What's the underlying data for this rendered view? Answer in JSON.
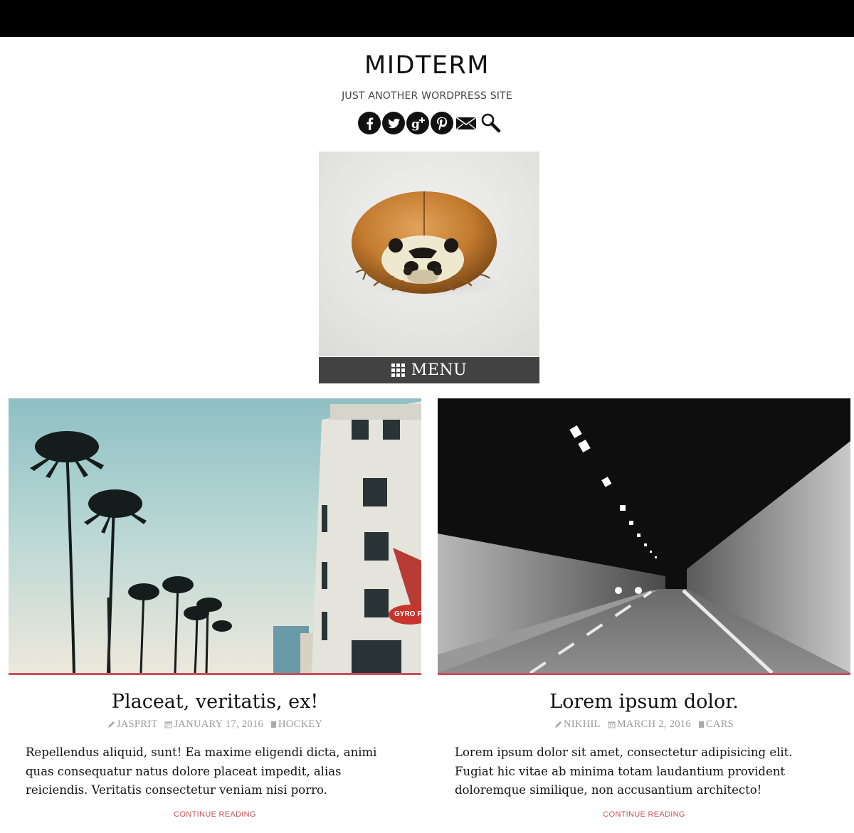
{
  "site": {
    "title": "MIDTERM",
    "tagline": "JUST ANOTHER WORDPRESS SITE"
  },
  "social_icons": [
    "facebook-icon",
    "twitter-icon",
    "google-plus-icon",
    "pinterest-icon",
    "email-icon",
    "search-icon"
  ],
  "menu": {
    "label": "MENU",
    "icon": "grid-icon"
  },
  "colors": {
    "accent": "#c9505a",
    "menu_bg": "#424242",
    "meta": "#999999",
    "topbar": "#000000"
  },
  "posts": [
    {
      "title": "Placeat, veritatis, ex!",
      "author": "JASPRIT",
      "date": "JANUARY 17, 2016",
      "category": "HOCKEY",
      "excerpt": "Repellendus aliquid, sunt! Ea maxime eligendi dicta, animi quas consequatur natus dolore placeat impedit, alias reiciendis. Veritatis consectetur veniam nisi porro.",
      "more": "CONTINUE READING",
      "image": "palm-trees-street-photo",
      "sign_text": "GYRO FALAFEL"
    },
    {
      "title": "Lorem ipsum dolor.",
      "author": "NIKHIL",
      "date": "MARCH 2, 2016",
      "category": "CARS",
      "excerpt": "Lorem ipsum dolor sit amet, consectetur adipisicing elit. Fugiat hic vitae ab minima totam laudantium provident doloremque similique, non accusantium architecto!",
      "more": "CONTINUE READING",
      "image": "tunnel-road-photo"
    }
  ]
}
